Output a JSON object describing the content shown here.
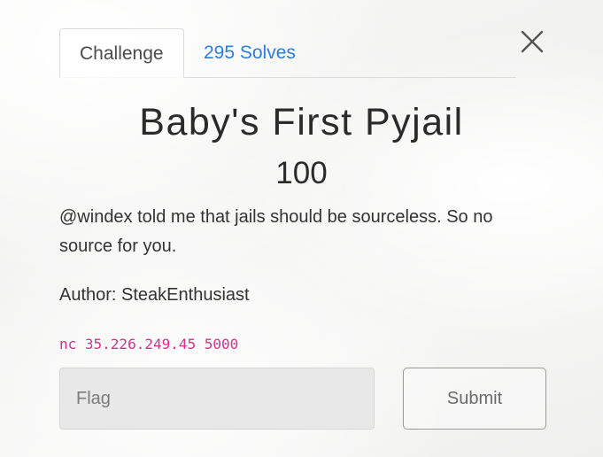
{
  "tabs": {
    "challenge_label": "Challenge",
    "solves_label": "295 Solves"
  },
  "challenge": {
    "name": "Baby's First Pyjail",
    "points": "100",
    "description": "@windex told me that jails should be sourceless. So no source for you.",
    "author": "Author: SteakEnthusiast",
    "connection": "nc 35.226.249.45 5000"
  },
  "form": {
    "flag_placeholder": "Flag",
    "flag_value": "",
    "submit_label": "Submit"
  },
  "icons": {
    "close": "close-icon"
  },
  "colors": {
    "link_blue": "#2a7de1",
    "code_pink": "#d1338c",
    "text_dark": "#2b2b2b"
  }
}
